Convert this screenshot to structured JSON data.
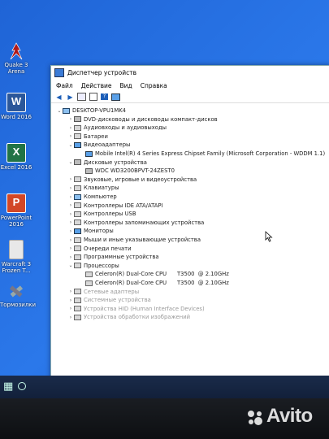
{
  "desktop_icons": [
    {
      "label": "Quake 3 Arena"
    },
    {
      "label": "Word 2016"
    },
    {
      "label": "Excel 2016"
    },
    {
      "label": "PowerPoint 2016"
    },
    {
      "label": "Warcraft 3 Frozen T..."
    },
    {
      "label": "Тормозилки"
    }
  ],
  "window": {
    "title": "Диспетчер устройств",
    "menu": [
      "Файл",
      "Действие",
      "Вид",
      "Справка"
    ]
  },
  "tree": [
    {
      "text": "DESKTOP-VPU1MK4",
      "exp": "⌄",
      "ico": "pc"
    },
    {
      "text": "DVD-дисководы и дисководы компакт-дисков",
      "exp": "›",
      "ico": "disk"
    },
    {
      "text": "Аудиовходы и аудиовыходы",
      "exp": "›",
      "ico": "chip"
    },
    {
      "text": "Батареи",
      "exp": "›",
      "ico": "chip"
    },
    {
      "text": "Видеоадаптеры",
      "exp": "⌄",
      "ico": "mon"
    },
    {
      "text": "Mobile Intel(R) 4 Series Express Chipset Family (Microsoft Corporation - WDDM 1.1)",
      "exp": "",
      "ico": "mon"
    },
    {
      "text": "Дисковые устройства",
      "exp": "⌄",
      "ico": "disk"
    },
    {
      "text": "WDC WD3200BPVT-24ZEST0",
      "exp": "",
      "ico": "disk"
    },
    {
      "text": "Звуковые, игровые и видеоустройства",
      "exp": "›",
      "ico": "chip"
    },
    {
      "text": "Клавиатуры",
      "exp": "›",
      "ico": "chip"
    },
    {
      "text": "Компьютер",
      "exp": "›",
      "ico": "pc"
    },
    {
      "text": "Контроллеры IDE ATA/ATAPI",
      "exp": "›",
      "ico": "chip"
    },
    {
      "text": "Контроллеры USB",
      "exp": "›",
      "ico": "chip"
    },
    {
      "text": "Контроллеры запоминающих устройства",
      "exp": "›",
      "ico": "chip"
    },
    {
      "text": "Мониторы",
      "exp": "›",
      "ico": "mon"
    },
    {
      "text": "Мыши и иные указывающие устройства",
      "exp": "›",
      "ico": "chip"
    },
    {
      "text": "Очереди печати",
      "exp": "›",
      "ico": "chip"
    },
    {
      "text": "Программные устройства",
      "exp": "›",
      "ico": "chip"
    },
    {
      "text": "Процессоры",
      "exp": "⌄",
      "ico": "chip"
    },
    {
      "text": "Celeron(R) Dual-Core CPU      T3500  @ 2.10GHz",
      "exp": "",
      "ico": "chip"
    },
    {
      "text": "Celeron(R) Dual-Core CPU      T3500  @ 2.10GHz",
      "exp": "",
      "ico": "chip"
    },
    {
      "text": "Сетевые адаптеры",
      "exp": "›",
      "ico": "chip"
    },
    {
      "text": "Системные устройства",
      "exp": "›",
      "ico": "chip"
    },
    {
      "text": "Устройства HID (Human Interface Devices)",
      "exp": "›",
      "ico": "chip"
    },
    {
      "text": "Устройства обработки изображений",
      "exp": "›",
      "ico": "chip"
    }
  ],
  "watermark": "Avito"
}
